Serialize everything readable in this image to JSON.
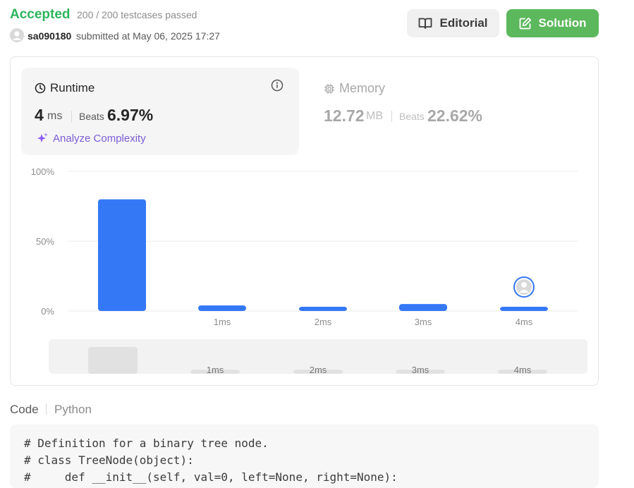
{
  "header": {
    "status": "Accepted",
    "testcases": "200 / 200 testcases passed",
    "username": "sa090180",
    "submitted_at": "submitted at May 06, 2025 17:27",
    "editorial_label": "Editorial",
    "solution_label": "Solution"
  },
  "runtime": {
    "title": "Runtime",
    "value": "4",
    "unit": "ms",
    "beats_label": "Beats",
    "beats_value": "6.97%",
    "analyze_label": "Analyze Complexity"
  },
  "memory": {
    "title": "Memory",
    "value": "12.72",
    "unit": "MB",
    "beats_label": "Beats",
    "beats_value": "22.62%"
  },
  "colors": {
    "accepted": "#2db55d",
    "solution_button": "#5cb85c",
    "bar": "#3478f6",
    "analyze": "#7b5cd6"
  },
  "chart_data": {
    "type": "bar",
    "categories": [
      "",
      "1ms",
      "2ms",
      "3ms",
      "4ms"
    ],
    "values": [
      80,
      4,
      3,
      5,
      3
    ],
    "ytick_labels": [
      "100%",
      "50%",
      "0%"
    ],
    "ylim": [
      0,
      100
    ],
    "highlight_category": "4ms",
    "grid": true,
    "overview_values": [
      20,
      3,
      3,
      3,
      3
    ]
  },
  "code": {
    "tab_label": "Code",
    "language": "Python",
    "lines": [
      "# Definition for a binary tree node.",
      "# class TreeNode(object):",
      "#     def __init__(self, val=0, left=None, right=None):"
    ]
  }
}
